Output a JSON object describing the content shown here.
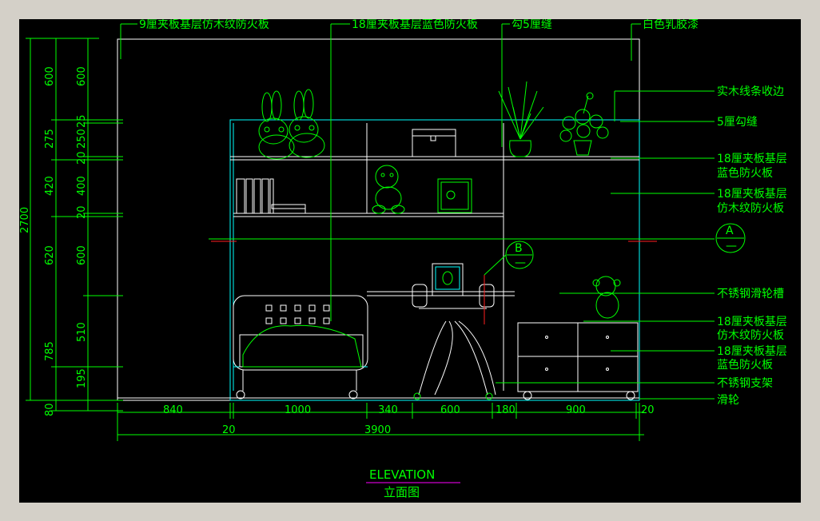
{
  "labels": {
    "top1": "9厘夹板基层仿木纹防火板",
    "top2": "18厘夹板基层蓝色防火板",
    "top3": "勾5厘缝",
    "top4": "白色乳胶漆",
    "r1": "实木线条收边",
    "r2": "5厘勾缝",
    "r3a": "18厘夹板基层",
    "r3b": "蓝色防火板",
    "r4a": "18厘夹板基层",
    "r4b": "仿木纹防火板",
    "r5": "不锈钢滑轮槽",
    "r6a": "18厘夹板基层",
    "r6b": "仿木纹防火板",
    "r7a": "18厘夹板基层",
    "r7b": "蓝色防火板",
    "r8": "不锈钢支架",
    "r9": "滑轮"
  },
  "markers": {
    "a": "A",
    "b": "B",
    "dash": "—"
  },
  "left_dims": {
    "outer": "2700",
    "mid": [
      "600",
      "275",
      "420",
      "620",
      "785",
      "80"
    ],
    "inner": [
      "600",
      "25",
      "250",
      "20",
      "400",
      "20",
      "600",
      "510",
      "195"
    ]
  },
  "bottom_dims": {
    "row1": [
      "840",
      "1000",
      "340",
      "600",
      "180",
      "900",
      "20"
    ],
    "row2": [
      "20",
      "3900"
    ]
  },
  "title": {
    "en": "ELEVATION",
    "zh": "立面图"
  },
  "colors": {
    "background": "#000000",
    "frame": "#d4d0c8",
    "annotation": "#00ff00",
    "outline": "#00ffff",
    "object": "#ffffff",
    "accent": "#ff00ff",
    "cut": "#ff2020"
  }
}
